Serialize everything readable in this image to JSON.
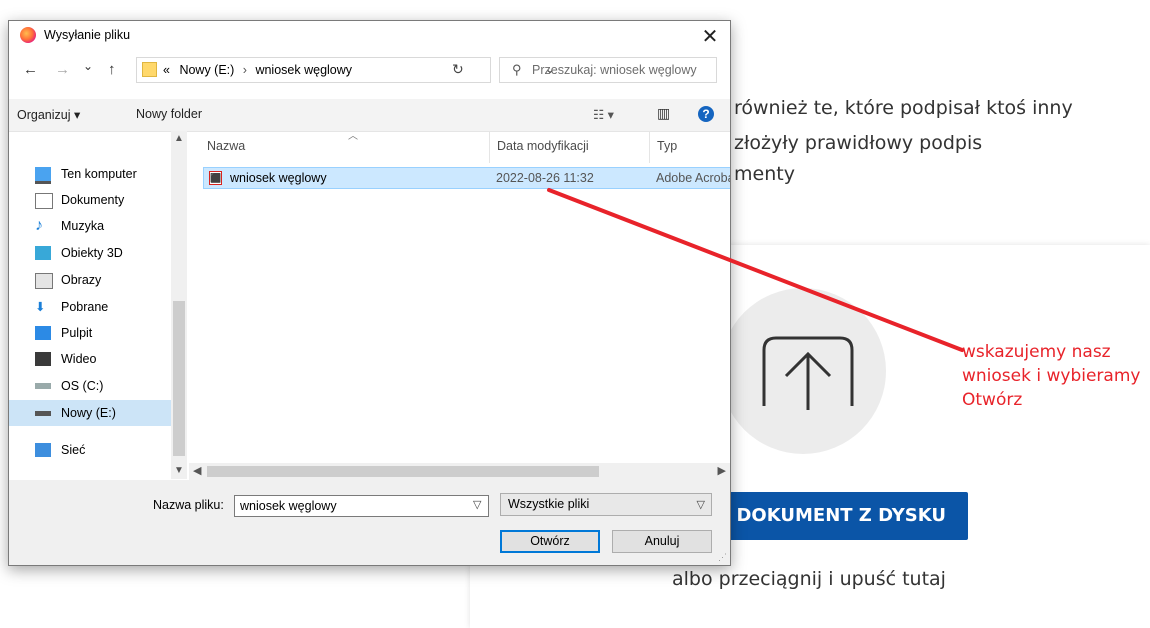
{
  "background": {
    "text_line1": "również te, które podpisał ktoś inny",
    "text_line2": "złożyły prawidłowy podpis",
    "text_line3": "menty",
    "choose_button": "RZ DOKUMENT Z DYSKU",
    "drop_text": "albo przeciągnij i upuść tutaj",
    "annotation": {
      "line1": "wskazujemy nasz",
      "line2": "wniosek i wybieramy",
      "line3": "Otwórz",
      "color": "#e8232a"
    }
  },
  "dialog": {
    "title": "Wysyłanie pliku",
    "close_glyph": "✕",
    "nav": {
      "back": "←",
      "forward": "→",
      "recent": "⌄",
      "up": "↑",
      "refresh": "↻"
    },
    "address": {
      "prefix": "«",
      "crumb1": "Nowy (E:)",
      "separator": "›",
      "crumb2": "wniosek węglowy",
      "chevron": "⌄"
    },
    "search_placeholder": "Przeszukaj: wniosek węglowy",
    "toolbar": {
      "organize": "Organizuj ▾",
      "new_folder": "Nowy folder",
      "view_glyph": "☷ ▾",
      "pane_glyph": "▥",
      "help": "?"
    },
    "tree": [
      {
        "label": "Ten komputer",
        "icon": "computer-icon",
        "selected": false
      },
      {
        "label": "Dokumenty",
        "icon": "documents-icon",
        "selected": false
      },
      {
        "label": "Muzyka",
        "icon": "music-icon",
        "selected": false
      },
      {
        "label": "Obiekty 3D",
        "icon": "cube-icon",
        "selected": false
      },
      {
        "label": "Obrazy",
        "icon": "pictures-icon",
        "selected": false
      },
      {
        "label": "Pobrane",
        "icon": "download-icon",
        "selected": false
      },
      {
        "label": "Pulpit",
        "icon": "desktop-icon",
        "selected": false
      },
      {
        "label": "Wideo",
        "icon": "video-icon",
        "selected": false
      },
      {
        "label": "OS (C:)",
        "icon": "drive-icon",
        "selected": false
      },
      {
        "label": "Nowy (E:)",
        "icon": "usb-drive-icon",
        "selected": true
      },
      {
        "label": "Sieć",
        "icon": "network-icon",
        "selected": false
      }
    ],
    "columns": {
      "name": "Nazwa",
      "date": "Data modyfikacji",
      "type": "Typ"
    },
    "files": [
      {
        "name": "wniosek węglowy",
        "date": "2022-08-26 11:32",
        "type": "Adobe Acrobat"
      }
    ],
    "footer": {
      "filename_label": "Nazwa pliku:",
      "filename_value": "wniosek węglowy",
      "filter_value": "Wszystkie pliki",
      "open_button": "Otwórz",
      "cancel_button": "Anuluj"
    }
  }
}
